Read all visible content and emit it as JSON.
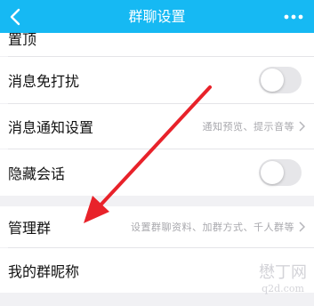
{
  "nav": {
    "title": "群聊设置",
    "back_icon": "chevron-left-icon",
    "more_icon": "more-dots-icon",
    "color": "#16b9f3"
  },
  "rows": {
    "top_partial": {
      "label": "置顶"
    },
    "mute": {
      "label": "消息免打扰",
      "toggle_on": false
    },
    "notify": {
      "label": "消息通知设置",
      "detail": "通知预览、提示音等"
    },
    "hide": {
      "label": "隐藏会话",
      "toggle_on": false
    },
    "manage": {
      "label": "管理群",
      "detail": "设置群聊资料、加群方式、千人群等"
    },
    "nickname": {
      "label": "我的群昵称"
    }
  },
  "annotation": {
    "arrow_color": "#e8222a",
    "icon": "red-arrow-annotation"
  },
  "watermark": {
    "line1": "懋丁网",
    "line2": "q2d.com"
  }
}
